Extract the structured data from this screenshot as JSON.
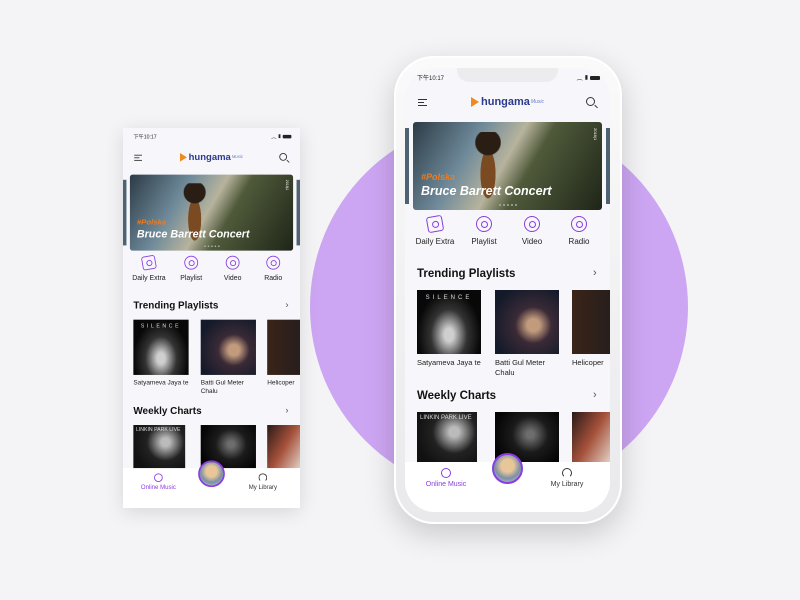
{
  "status_bar": {
    "time": "下午10:17"
  },
  "header": {
    "logo_text": "hungama",
    "logo_sub": "Music",
    "menu_icon": "hamburger-menu-icon",
    "search_icon": "search-icon"
  },
  "banner": {
    "tag": "#Polska",
    "title": "Bruce Barrett Concert",
    "side_text": "2018|1"
  },
  "categories": [
    {
      "label": "Daily Extra",
      "icon": "music-card-icon"
    },
    {
      "label": "Playlist",
      "icon": "music-note-disc-icon"
    },
    {
      "label": "Video",
      "icon": "film-reel-icon"
    },
    {
      "label": "Radio",
      "icon": "radio-broadcast-icon"
    }
  ],
  "trending": {
    "title": "Trending Playlists",
    "items": [
      {
        "caption": "Satyameva Jaya te",
        "cover_text": "SILENCE"
      },
      {
        "caption": "Batti Gul Meter Chalu"
      },
      {
        "caption": "Helicoper"
      }
    ]
  },
  "weekly": {
    "title": "Weekly Charts",
    "items": [
      {
        "cover_text": "LINKIN PARK LIVE"
      },
      {},
      {}
    ]
  },
  "bottom_nav": {
    "online": "Online Music",
    "library": "My Library"
  },
  "colors": {
    "accent": "#8a3de0",
    "circle": "#cda6f3",
    "banner_tag": "#f27a1a"
  }
}
